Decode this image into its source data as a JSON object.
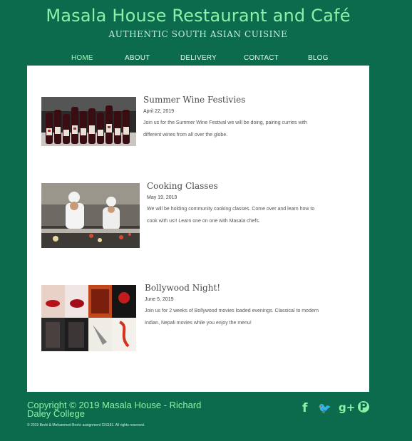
{
  "header": {
    "title": "Masala House Restaurant and Café",
    "subtitle": "AUTHENTIC SOUTH ASIAN CUISINE"
  },
  "nav": [
    {
      "label": "HOME",
      "active": true
    },
    {
      "label": "ABOUT"
    },
    {
      "label": "DELIVERY"
    },
    {
      "label": "CONTACT"
    },
    {
      "label": "BLOG"
    }
  ],
  "posts": [
    {
      "title": "Summer Wine Festivies",
      "date": "April 22, 2019",
      "text_lines": [
        "Join us for the Summer Wine Festival we will be doing, pairing curries with",
        "different wines from all over the globe."
      ],
      "image": "wine-bottles"
    },
    {
      "title": "Cooking Classes",
      "date": "May 19, 2019",
      "text_lines": [
        "We will be holding community cooking classes. Come over and learn how to",
        "cook with us!! Learn one on one with Masala chefs."
      ],
      "image": "chefs-kitchen"
    },
    {
      "title": "Bollywood Night!",
      "date": "June 5, 2019",
      "text_lines": [
        "Join us for 2 weeks of Bollywood movies loaded evenings. Classical to modern",
        "Indian, Nepali movies while you enjoy the menu!"
      ],
      "image": "movie-posters-collage"
    }
  ],
  "footer": {
    "copyright": "Copyright © 2019 Masala House - Richard Daley College",
    "small": "© 2019 Brohi & Mohammed Brohi: assignment CIS181. All rights reserved.",
    "social": [
      {
        "icon": "facebook-icon",
        "glyph": "f"
      },
      {
        "icon": "twitter-icon",
        "glyph": "🐦"
      },
      {
        "icon": "google-plus-icon",
        "glyph": "g+"
      },
      {
        "icon": "pinterest-icon",
        "glyph": "P"
      }
    ]
  },
  "colors": {
    "background": "#0b6b4c",
    "accent": "#8cf0a8",
    "content": "#ffffff"
  }
}
